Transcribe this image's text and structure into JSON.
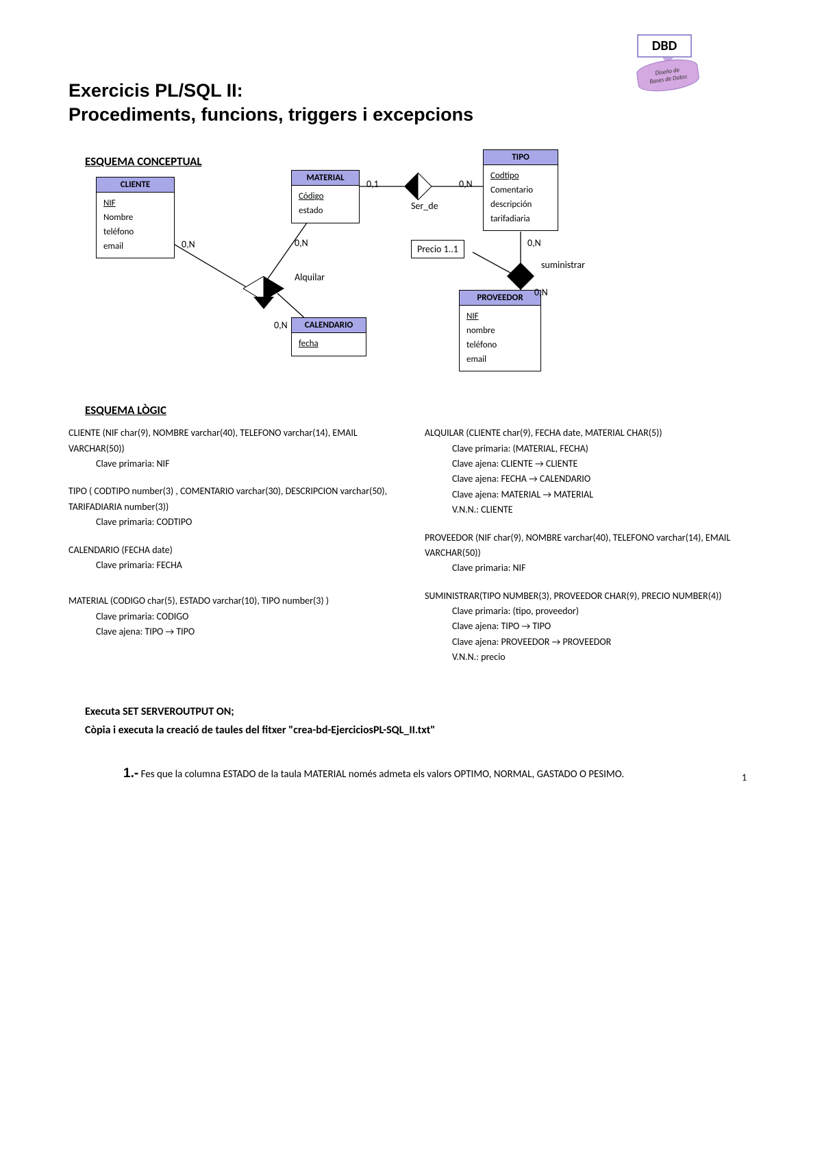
{
  "logo": {
    "title": "DBD",
    "subtitle": "Diseño de\nBases de Datos"
  },
  "title": "Exercicis PL/SQL II:\nProcediments, funcions, triggers i excepcions",
  "section_conceptual": "ESQUEMA CONCEPTUAL",
  "er": {
    "cliente": {
      "title": "CLIENTE",
      "attrs": [
        "NIF",
        "Nombre",
        "teléfono",
        "email"
      ]
    },
    "material": {
      "title": "MATERIAL",
      "attrs": [
        "Código",
        "estado"
      ]
    },
    "tipo": {
      "title": "TIPO",
      "attrs": [
        "Codtipo",
        "Comentario",
        "descripción",
        "tarifadiaria"
      ]
    },
    "calendario": {
      "title": "CALENDARIO",
      "attrs": [
        "fecha"
      ]
    },
    "proveedor": {
      "title": "PROVEEDOR",
      "attrs": [
        "NIF",
        "nombre",
        "teléfono",
        "email"
      ]
    }
  },
  "rel": {
    "ser_de": "Ser_de",
    "alquilar": "Alquilar",
    "suministrar": "suministrar",
    "precio": "Precio 1..1"
  },
  "card": {
    "cliente_alq": "0,N",
    "mat_alq": "0,N",
    "cal_alq": "0,N",
    "mat_ser": "0,1",
    "tipo_ser": "0,N",
    "tipo_sum": "0,N",
    "prov_sum": "0,N"
  },
  "section_logic": "ESQUEMA LÒGIC",
  "schema": {
    "cliente": {
      "def": "CLIENTE (NIF char(9), NOMBRE varchar(40), TELEFONO varchar(14), EMAIL  VARCHAR(50))",
      "pk": "Clave primaria: NIF"
    },
    "tipo": {
      "def": "TIPO ( CODTIPO number(3) , COMENTARIO  varchar(30), DESCRIPCION varchar(50), TARIFADIARIA number(3))",
      "pk": "Clave primaria: CODTIPO"
    },
    "calendario": {
      "def": "CALENDARIO (FECHA date)",
      "pk": "Clave primaria: FECHA"
    },
    "material": {
      "def": "MATERIAL (CODIGO char(5), ESTADO  varchar(10), TIPO number(3) )",
      "pk": "Clave primaria: CODIGO",
      "fk1": "Clave ajena: TIPO → TIPO"
    },
    "alquilar": {
      "def": "ALQUILAR (CLIENTE char(9), FECHA date, MATERIAL CHAR(5))",
      "pk": "Clave primaria: (MATERIAL, FECHA)",
      "fk1": "Clave ajena: CLIENTE →  CLIENTE",
      "fk2": "Clave ajena: FECHA → CALENDARIO",
      "fk3": "Clave ajena: MATERIAL → MATERIAL",
      "vnn": "V.N.N.: CLIENTE"
    },
    "proveedor": {
      "def": "PROVEEDOR (NIF char(9), NOMBRE varchar(40), TELEFONO varchar(14), EMAIL  VARCHAR(50))",
      "pk": "Clave primaria: NIF"
    },
    "suministrar": {
      "def": "SUMINISTRAR(TIPO NUMBER(3), PROVEEDOR CHAR(9), PRECIO NUMBER(4))",
      "pk": "Clave primaria: (tipo, proveedor)",
      "fk1": "Clave ajena: TIPO → TIPO",
      "fk2": "Clave ajena: PROVEEDOR → PROVEEDOR",
      "vnn": "V.N.N.: precio"
    }
  },
  "instructions": {
    "line1": "Executa SET SERVEROUTPUT ON;",
    "line2": "Còpia i executa la creació de taules del fitxer \"crea-bd-EjerciciosPL-SQL_II.txt\""
  },
  "exercise": {
    "num": "1.-",
    "text": " Fes que la columna ESTADO de la taula MATERIAL només admeta els valors OPTIMO, NORMAL, GASTADO O PESIMO."
  },
  "page_number": "1"
}
